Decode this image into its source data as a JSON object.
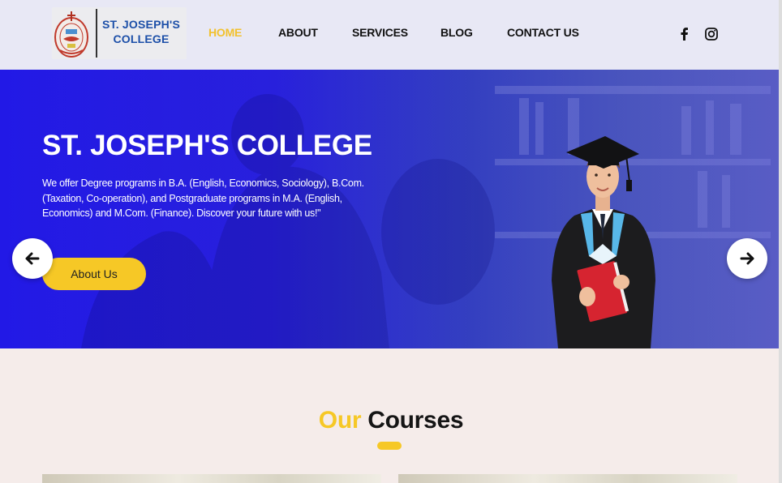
{
  "brand": {
    "name_line1": "ST. JOSEPH'S",
    "name_line2": "COLLEGE"
  },
  "nav": {
    "items": [
      {
        "label": "HOME",
        "active": true
      },
      {
        "label": "ABOUT"
      },
      {
        "label": "SERVICES"
      },
      {
        "label": "BLOG"
      },
      {
        "label": "CONTACT US"
      }
    ],
    "active_color": "#f2c12e"
  },
  "social": [
    "facebook-icon",
    "instagram-icon"
  ],
  "hero": {
    "title": "ST. JOSEPH'S COLLEGE",
    "description": "We offer Degree programs in B.A. (English, Economics, Sociology), B.Com. (Taxation, Co-operation), and Postgraduate programs in M.A. (English, Economics) and M.Com. (Finance). Discover your future with us!\"",
    "button_label": "About Us",
    "prev_icon": "arrow-left-icon",
    "next_icon": "arrow-right-icon",
    "background_color": "#2219e6",
    "accent_color": "#f6c826"
  },
  "courses": {
    "title_part1": "Our",
    "title_part2": "Courses"
  }
}
